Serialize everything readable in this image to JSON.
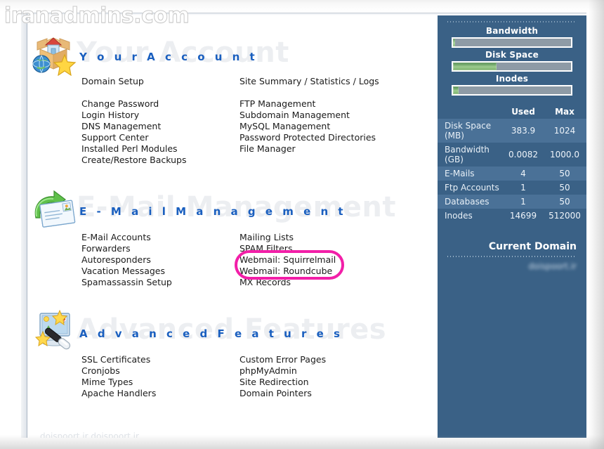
{
  "watermark": "iranadmins.com",
  "footer_faint": "doispoort ir doispoort ir",
  "sections": [
    {
      "id": "your-account",
      "title": "Y o u r   A c c o u n t",
      "ghost": "Your Account",
      "icon": "box-house-globe-star-icon",
      "intro": {
        "left": "Domain Setup",
        "right": "Site Summary / Statistics / Logs"
      },
      "left_links": [
        "Change Password",
        "Login History",
        "DNS Management",
        "Support Center",
        "Installed Perl Modules",
        "Create/Restore Backups"
      ],
      "right_links": [
        "FTP Management",
        "Subdomain Management",
        "MySQL Management",
        "Password Protected Directories",
        "File Manager"
      ]
    },
    {
      "id": "email-management",
      "title": "E - M a i l   M a n a g e m e n t",
      "ghost": "E-Mail Management",
      "icon": "envelope-green-arrow-icon",
      "left_links": [
        "E-Mail Accounts",
        "Forwarders",
        "Autoresponders",
        "Vacation Messages",
        "Spamassassin Setup"
      ],
      "right_links": [
        "Mailing Lists",
        "SPAM Filters",
        "Webmail: Squirrelmail",
        "Webmail: Roundcube",
        "MX Records"
      ]
    },
    {
      "id": "advanced-features",
      "title": "A d v a n c e d   F e a t u r e s",
      "ghost": "Advanced Features",
      "icon": "monitor-magic-wand-icon",
      "left_links": [
        "SSL Certificates",
        "Cronjobs",
        "Mime Types",
        "Apache Handlers"
      ],
      "right_links": [
        "Custom Error Pages",
        "phpMyAdmin",
        "Site Redirection",
        "Domain Pointers"
      ]
    }
  ],
  "highlight": {
    "color": "#f21fa8",
    "targets": [
      "Webmail: Squirrelmail",
      "Webmail: Roundcube"
    ]
  },
  "sidebar": {
    "meters": [
      {
        "label": "Bandwidth",
        "percent": 1
      },
      {
        "label": "Disk Space",
        "percent": 37
      },
      {
        "label": "Inodes",
        "percent": 3
      }
    ],
    "table": {
      "headers": [
        "",
        "Used",
        "Max"
      ],
      "rows": [
        {
          "label": "Disk Space (MB)",
          "used": "383.9",
          "max": "1024"
        },
        {
          "label": "Bandwidth (GB)",
          "used": "0.0082",
          "max": "1000.0"
        },
        {
          "label": "E-Mails",
          "used": "4",
          "max": "50"
        },
        {
          "label": "Ftp Accounts",
          "used": "1",
          "max": "50"
        },
        {
          "label": "Databases",
          "used": "1",
          "max": "50"
        },
        {
          "label": "Inodes",
          "used": "14699",
          "max": "512000"
        }
      ]
    },
    "current_domain_label": "Current Domain",
    "current_domain_value": "doispoort.ir",
    "bg_color": "#3a6186",
    "row_alt_color": "#4a7197"
  }
}
